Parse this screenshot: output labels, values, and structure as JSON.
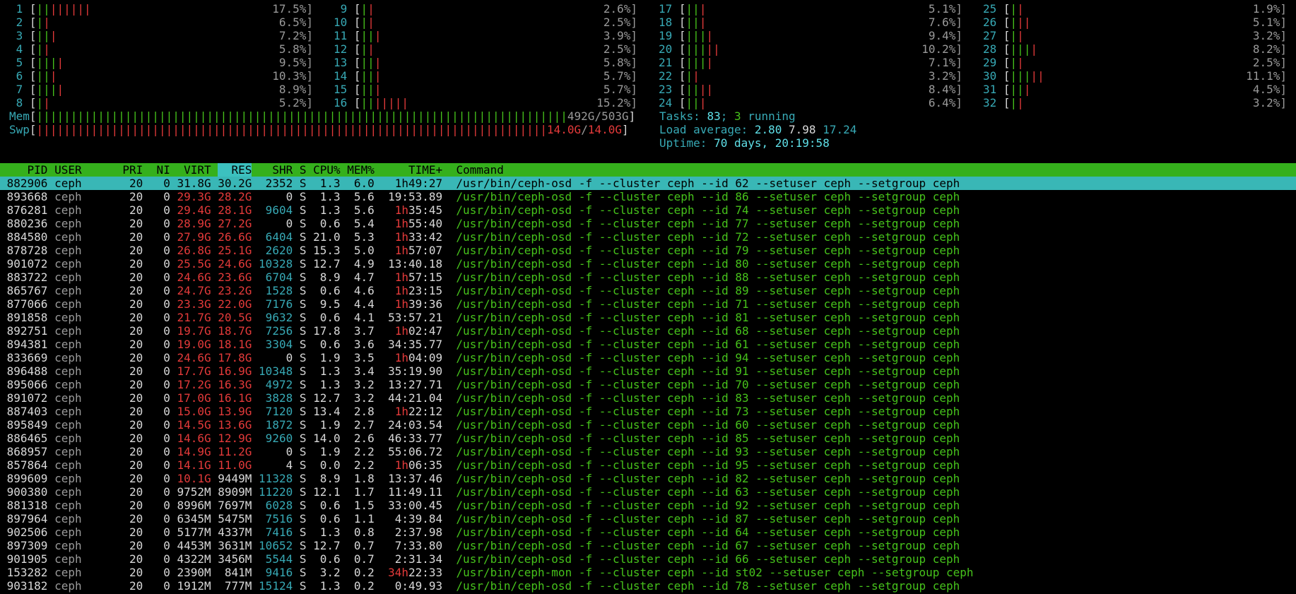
{
  "cpus": [
    {
      "id": "1",
      "pct": "17.5%",
      "bars": [
        [
          "||",
          "green"
        ],
        [
          "||||||",
          "red"
        ]
      ]
    },
    {
      "id": "2",
      "pct": "6.5%",
      "bars": [
        [
          "|",
          "green"
        ],
        [
          "|",
          "red"
        ]
      ]
    },
    {
      "id": "3",
      "pct": "7.2%",
      "bars": [
        [
          "||",
          "green"
        ],
        [
          "|",
          "red"
        ]
      ]
    },
    {
      "id": "4",
      "pct": "5.8%",
      "bars": [
        [
          "|",
          "green"
        ],
        [
          "|",
          "red"
        ]
      ]
    },
    {
      "id": "5",
      "pct": "9.5%",
      "bars": [
        [
          "|||",
          "green"
        ],
        [
          "|",
          "red"
        ]
      ]
    },
    {
      "id": "6",
      "pct": "10.3%",
      "bars": [
        [
          "||",
          "green"
        ],
        [
          "|",
          "red"
        ]
      ]
    },
    {
      "id": "7",
      "pct": "8.9%",
      "bars": [
        [
          "|||",
          "green"
        ],
        [
          "|",
          "red"
        ]
      ]
    },
    {
      "id": "8",
      "pct": "5.2%",
      "bars": [
        [
          "|",
          "green"
        ],
        [
          "|",
          "red"
        ]
      ]
    },
    {
      "id": "9",
      "pct": "2.6%",
      "bars": [
        [
          "|",
          "green"
        ],
        [
          "|",
          "red"
        ]
      ]
    },
    {
      "id": "10",
      "pct": "2.5%",
      "bars": [
        [
          "|",
          "green"
        ],
        [
          "|",
          "red"
        ]
      ]
    },
    {
      "id": "11",
      "pct": "3.9%",
      "bars": [
        [
          "||",
          "green"
        ],
        [
          "|",
          "red"
        ]
      ]
    },
    {
      "id": "12",
      "pct": "2.5%",
      "bars": [
        [
          "|",
          "green"
        ],
        [
          "|",
          "red"
        ]
      ]
    },
    {
      "id": "13",
      "pct": "5.8%",
      "bars": [
        [
          "||",
          "green"
        ],
        [
          "|",
          "red"
        ]
      ]
    },
    {
      "id": "14",
      "pct": "5.7%",
      "bars": [
        [
          "||",
          "green"
        ],
        [
          "|",
          "red"
        ]
      ]
    },
    {
      "id": "15",
      "pct": "5.7%",
      "bars": [
        [
          "||",
          "green"
        ],
        [
          "|",
          "red"
        ]
      ]
    },
    {
      "id": "16",
      "pct": "15.2%",
      "bars": [
        [
          "||",
          "green"
        ],
        [
          "|||||",
          "red"
        ]
      ]
    },
    {
      "id": "17",
      "pct": "5.1%",
      "bars": [
        [
          "||",
          "green"
        ],
        [
          "|",
          "red"
        ]
      ]
    },
    {
      "id": "18",
      "pct": "7.6%",
      "bars": [
        [
          "||",
          "green"
        ],
        [
          "|",
          "red"
        ]
      ]
    },
    {
      "id": "19",
      "pct": "9.4%",
      "bars": [
        [
          "|||",
          "green"
        ],
        [
          "|",
          "red"
        ]
      ]
    },
    {
      "id": "20",
      "pct": "10.2%",
      "bars": [
        [
          "|||",
          "green"
        ],
        [
          "||",
          "red"
        ]
      ]
    },
    {
      "id": "21",
      "pct": "7.1%",
      "bars": [
        [
          "|||",
          "green"
        ],
        [
          "|",
          "red"
        ]
      ]
    },
    {
      "id": "22",
      "pct": "3.2%",
      "bars": [
        [
          "|",
          "green"
        ],
        [
          "|",
          "red"
        ]
      ]
    },
    {
      "id": "23",
      "pct": "8.4%",
      "bars": [
        [
          "||",
          "green"
        ],
        [
          "||",
          "red"
        ]
      ]
    },
    {
      "id": "24",
      "pct": "6.4%",
      "bars": [
        [
          "||",
          "green"
        ],
        [
          "|",
          "red"
        ]
      ]
    },
    {
      "id": "25",
      "pct": "1.9%",
      "bars": [
        [
          "|",
          "green"
        ],
        [
          "|",
          "red"
        ]
      ]
    },
    {
      "id": "26",
      "pct": "5.1%",
      "bars": [
        [
          "|",
          "green"
        ],
        [
          "||",
          "red"
        ]
      ]
    },
    {
      "id": "27",
      "pct": "3.2%",
      "bars": [
        [
          "|",
          "green"
        ],
        [
          "|",
          "red"
        ]
      ]
    },
    {
      "id": "28",
      "pct": "8.2%",
      "bars": [
        [
          "|||",
          "green"
        ],
        [
          "|",
          "red"
        ]
      ]
    },
    {
      "id": "29",
      "pct": "2.5%",
      "bars": [
        [
          "|",
          "green"
        ],
        [
          "|",
          "red"
        ]
      ]
    },
    {
      "id": "30",
      "pct": "11.1%",
      "bars": [
        [
          "|||",
          "green"
        ],
        [
          "||",
          "red"
        ]
      ]
    },
    {
      "id": "31",
      "pct": "4.5%",
      "bars": [
        [
          "||",
          "green"
        ],
        [
          "|",
          "red"
        ]
      ]
    },
    {
      "id": "32",
      "pct": "3.2%",
      "bars": [
        [
          "|",
          "green"
        ],
        [
          "|",
          "red"
        ]
      ]
    }
  ],
  "mem": {
    "label": "Mem",
    "bars": "||||||||||||||||||||||||||||||||||||||||||||||||||||||||||||||||||||||||||||||",
    "used": "492G",
    "total": "503G"
  },
  "swp": {
    "label": "Swp",
    "bars": "|||||||||||||||||||||||||||||||||||||||||||||||||||||||||||||||||||||||||||",
    "used": "14.0G",
    "total": "14.0G"
  },
  "tasks": {
    "label": "Tasks: ",
    "count": "83",
    "sep": "; ",
    "running": "3",
    "running_label": " running"
  },
  "load": {
    "label": "Load average: ",
    "l1": "2.80",
    "l5": "7.98",
    "l15": "17.24"
  },
  "uptime": {
    "label": "Uptime: ",
    "value": "70 days, 20:19:58"
  },
  "header": {
    "pid": "PID",
    "user": "USER",
    "pri": "PRI",
    "ni": "NI",
    "virt": "VIRT",
    "res": "RES",
    "shr": "SHR",
    "s": "S",
    "cpu": "CPU%",
    "mem": "MEM%",
    "time": "TIME+",
    "cmd": "Command"
  },
  "processes": [
    {
      "pid": "882906",
      "user": "ceph",
      "pri": "20",
      "ni": "0",
      "virt": "31.8G",
      "res": "30.2G",
      "shr": "2352",
      "s": "S",
      "cpu": "1.3",
      "mem": "6.0",
      "time_h": "1h",
      "time_r": "49:27",
      "cmd": "/usr/bin/ceph-osd -f --cluster ceph --id 62 --setuser ceph --setgroup ceph"
    },
    {
      "pid": "893668",
      "user": "ceph",
      "pri": "20",
      "ni": "0",
      "virt": "29.3G",
      "res": "28.2G",
      "shr": "0",
      "s": "S",
      "cpu": "1.3",
      "mem": "5.6",
      "time_h": "",
      "time_r": "19:53.89",
      "cmd": "/usr/bin/ceph-osd -f --cluster ceph --id 86 --setuser ceph --setgroup ceph"
    },
    {
      "pid": "876281",
      "user": "ceph",
      "pri": "20",
      "ni": "0",
      "virt": "29.4G",
      "res": "28.1G",
      "shr": "9604",
      "s": "S",
      "cpu": "1.3",
      "mem": "5.6",
      "time_h": "1h",
      "time_r": "35:45",
      "cmd": "/usr/bin/ceph-osd -f --cluster ceph --id 74 --setuser ceph --setgroup ceph"
    },
    {
      "pid": "880236",
      "user": "ceph",
      "pri": "20",
      "ni": "0",
      "virt": "28.9G",
      "res": "27.2G",
      "shr": "0",
      "s": "S",
      "cpu": "0.6",
      "mem": "5.4",
      "time_h": "1h",
      "time_r": "55:40",
      "cmd": "/usr/bin/ceph-osd -f --cluster ceph --id 77 --setuser ceph --setgroup ceph"
    },
    {
      "pid": "884580",
      "user": "ceph",
      "pri": "20",
      "ni": "0",
      "virt": "27.9G",
      "res": "26.6G",
      "shr": "6404",
      "s": "S",
      "cpu": "21.0",
      "mem": "5.3",
      "time_h": "1h",
      "time_r": "33:42",
      "cmd": "/usr/bin/ceph-osd -f --cluster ceph --id 72 --setuser ceph --setgroup ceph"
    },
    {
      "pid": "878728",
      "user": "ceph",
      "pri": "20",
      "ni": "0",
      "virt": "26.8G",
      "res": "25.1G",
      "shr": "2620",
      "s": "S",
      "cpu": "15.3",
      "mem": "5.0",
      "time_h": "1h",
      "time_r": "57:07",
      "cmd": "/usr/bin/ceph-osd -f --cluster ceph --id 79 --setuser ceph --setgroup ceph"
    },
    {
      "pid": "901072",
      "user": "ceph",
      "pri": "20",
      "ni": "0",
      "virt": "25.5G",
      "res": "24.6G",
      "shr": "10328",
      "s": "S",
      "cpu": "12.7",
      "mem": "4.9",
      "time_h": "",
      "time_r": "13:40.18",
      "cmd": "/usr/bin/ceph-osd -f --cluster ceph --id 80 --setuser ceph --setgroup ceph"
    },
    {
      "pid": "883722",
      "user": "ceph",
      "pri": "20",
      "ni": "0",
      "virt": "24.6G",
      "res": "23.6G",
      "shr": "6704",
      "s": "S",
      "cpu": "8.9",
      "mem": "4.7",
      "time_h": "1h",
      "time_r": "57:15",
      "cmd": "/usr/bin/ceph-osd -f --cluster ceph --id 88 --setuser ceph --setgroup ceph"
    },
    {
      "pid": "865767",
      "user": "ceph",
      "pri": "20",
      "ni": "0",
      "virt": "24.7G",
      "res": "23.2G",
      "shr": "1528",
      "s": "S",
      "cpu": "0.6",
      "mem": "4.6",
      "time_h": "1h",
      "time_r": "23:15",
      "cmd": "/usr/bin/ceph-osd -f --cluster ceph --id 89 --setuser ceph --setgroup ceph"
    },
    {
      "pid": "877066",
      "user": "ceph",
      "pri": "20",
      "ni": "0",
      "virt": "23.3G",
      "res": "22.0G",
      "shr": "7176",
      "s": "S",
      "cpu": "9.5",
      "mem": "4.4",
      "time_h": "1h",
      "time_r": "39:36",
      "cmd": "/usr/bin/ceph-osd -f --cluster ceph --id 71 --setuser ceph --setgroup ceph"
    },
    {
      "pid": "891858",
      "user": "ceph",
      "pri": "20",
      "ni": "0",
      "virt": "21.7G",
      "res": "20.5G",
      "shr": "9632",
      "s": "S",
      "cpu": "0.6",
      "mem": "4.1",
      "time_h": "",
      "time_r": "53:57.21",
      "cmd": "/usr/bin/ceph-osd -f --cluster ceph --id 81 --setuser ceph --setgroup ceph"
    },
    {
      "pid": "892751",
      "user": "ceph",
      "pri": "20",
      "ni": "0",
      "virt": "19.7G",
      "res": "18.7G",
      "shr": "7256",
      "s": "S",
      "cpu": "17.8",
      "mem": "3.7",
      "time_h": "1h",
      "time_r": "02:47",
      "cmd": "/usr/bin/ceph-osd -f --cluster ceph --id 68 --setuser ceph --setgroup ceph"
    },
    {
      "pid": "894381",
      "user": "ceph",
      "pri": "20",
      "ni": "0",
      "virt": "19.0G",
      "res": "18.1G",
      "shr": "3304",
      "s": "S",
      "cpu": "0.6",
      "mem": "3.6",
      "time_h": "",
      "time_r": "34:35.77",
      "cmd": "/usr/bin/ceph-osd -f --cluster ceph --id 61 --setuser ceph --setgroup ceph"
    },
    {
      "pid": "833669",
      "user": "ceph",
      "pri": "20",
      "ni": "0",
      "virt": "24.6G",
      "res": "17.8G",
      "shr": "0",
      "s": "S",
      "cpu": "1.9",
      "mem": "3.5",
      "time_h": "1h",
      "time_r": "04:09",
      "cmd": "/usr/bin/ceph-osd -f --cluster ceph --id 94 --setuser ceph --setgroup ceph"
    },
    {
      "pid": "896488",
      "user": "ceph",
      "pri": "20",
      "ni": "0",
      "virt": "17.7G",
      "res": "16.9G",
      "shr": "10348",
      "s": "S",
      "cpu": "1.3",
      "mem": "3.4",
      "time_h": "",
      "time_r": "35:19.90",
      "cmd": "/usr/bin/ceph-osd -f --cluster ceph --id 91 --setuser ceph --setgroup ceph"
    },
    {
      "pid": "895066",
      "user": "ceph",
      "pri": "20",
      "ni": "0",
      "virt": "17.2G",
      "res": "16.3G",
      "shr": "4972",
      "s": "S",
      "cpu": "1.3",
      "mem": "3.2",
      "time_h": "",
      "time_r": "13:27.71",
      "cmd": "/usr/bin/ceph-osd -f --cluster ceph --id 70 --setuser ceph --setgroup ceph"
    },
    {
      "pid": "891072",
      "user": "ceph",
      "pri": "20",
      "ni": "0",
      "virt": "17.0G",
      "res": "16.1G",
      "shr": "3828",
      "s": "S",
      "cpu": "12.7",
      "mem": "3.2",
      "time_h": "",
      "time_r": "44:21.04",
      "cmd": "/usr/bin/ceph-osd -f --cluster ceph --id 83 --setuser ceph --setgroup ceph"
    },
    {
      "pid": "887403",
      "user": "ceph",
      "pri": "20",
      "ni": "0",
      "virt": "15.0G",
      "res": "13.9G",
      "shr": "7120",
      "s": "S",
      "cpu": "13.4",
      "mem": "2.8",
      "time_h": "1h",
      "time_r": "22:12",
      "cmd": "/usr/bin/ceph-osd -f --cluster ceph --id 73 --setuser ceph --setgroup ceph"
    },
    {
      "pid": "895849",
      "user": "ceph",
      "pri": "20",
      "ni": "0",
      "virt": "14.5G",
      "res": "13.6G",
      "shr": "1872",
      "s": "S",
      "cpu": "1.9",
      "mem": "2.7",
      "time_h": "",
      "time_r": "24:03.54",
      "cmd": "/usr/bin/ceph-osd -f --cluster ceph --id 60 --setuser ceph --setgroup ceph"
    },
    {
      "pid": "886465",
      "user": "ceph",
      "pri": "20",
      "ni": "0",
      "virt": "14.6G",
      "res": "12.9G",
      "shr": "9260",
      "s": "S",
      "cpu": "14.0",
      "mem": "2.6",
      "time_h": "",
      "time_r": "46:33.77",
      "cmd": "/usr/bin/ceph-osd -f --cluster ceph --id 85 --setuser ceph --setgroup ceph"
    },
    {
      "pid": "868957",
      "user": "ceph",
      "pri": "20",
      "ni": "0",
      "virt": "14.9G",
      "res": "11.2G",
      "shr": "0",
      "s": "S",
      "cpu": "1.9",
      "mem": "2.2",
      "time_h": "",
      "time_r": "55:06.72",
      "cmd": "/usr/bin/ceph-osd -f --cluster ceph --id 93 --setuser ceph --setgroup ceph"
    },
    {
      "pid": "857864",
      "user": "ceph",
      "pri": "20",
      "ni": "0",
      "virt": "14.1G",
      "res": "11.0G",
      "shr": "4",
      "s": "S",
      "cpu": "0.0",
      "mem": "2.2",
      "time_h": "1h",
      "time_r": "06:35",
      "cmd": "/usr/bin/ceph-osd -f --cluster ceph --id 95 --setuser ceph --setgroup ceph"
    },
    {
      "pid": "899609",
      "user": "ceph",
      "pri": "20",
      "ni": "0",
      "virt": "10.1G",
      "res": "9449M",
      "shr": "11328",
      "s": "S",
      "cpu": "8.9",
      "mem": "1.8",
      "time_h": "",
      "time_r": "13:37.46",
      "cmd": "/usr/bin/ceph-osd -f --cluster ceph --id 82 --setuser ceph --setgroup ceph"
    },
    {
      "pid": "900380",
      "user": "ceph",
      "pri": "20",
      "ni": "0",
      "virt": "9752M",
      "res": "8909M",
      "shr": "11220",
      "s": "S",
      "cpu": "12.1",
      "mem": "1.7",
      "time_h": "",
      "time_r": "11:49.11",
      "cmd": "/usr/bin/ceph-osd -f --cluster ceph --id 63 --setuser ceph --setgroup ceph"
    },
    {
      "pid": "881318",
      "user": "ceph",
      "pri": "20",
      "ni": "0",
      "virt": "8996M",
      "res": "7697M",
      "shr": "6028",
      "s": "S",
      "cpu": "0.6",
      "mem": "1.5",
      "time_h": "",
      "time_r": "33:00.45",
      "cmd": "/usr/bin/ceph-osd -f --cluster ceph --id 92 --setuser ceph --setgroup ceph"
    },
    {
      "pid": "897964",
      "user": "ceph",
      "pri": "20",
      "ni": "0",
      "virt": "6345M",
      "res": "5475M",
      "shr": "7516",
      "s": "S",
      "cpu": "0.6",
      "mem": "1.1",
      "time_h": "",
      "time_r": "4:39.84",
      "cmd": "/usr/bin/ceph-osd -f --cluster ceph --id 87 --setuser ceph --setgroup ceph"
    },
    {
      "pid": "902506",
      "user": "ceph",
      "pri": "20",
      "ni": "0",
      "virt": "5177M",
      "res": "4337M",
      "shr": "7416",
      "s": "S",
      "cpu": "1.3",
      "mem": "0.8",
      "time_h": "",
      "time_r": "2:37.98",
      "cmd": "/usr/bin/ceph-osd -f --cluster ceph --id 64 --setuser ceph --setgroup ceph"
    },
    {
      "pid": "897309",
      "user": "ceph",
      "pri": "20",
      "ni": "0",
      "virt": "4453M",
      "res": "3631M",
      "shr": "10652",
      "s": "S",
      "cpu": "12.7",
      "mem": "0.7",
      "time_h": "",
      "time_r": "7:33.80",
      "cmd": "/usr/bin/ceph-osd -f --cluster ceph --id 67 --setuser ceph --setgroup ceph"
    },
    {
      "pid": "901905",
      "user": "ceph",
      "pri": "20",
      "ni": "0",
      "virt": "4322M",
      "res": "3456M",
      "shr": "5544",
      "s": "S",
      "cpu": "0.6",
      "mem": "0.7",
      "time_h": "",
      "time_r": "2:31.34",
      "cmd": "/usr/bin/ceph-osd -f --cluster ceph --id 66 --setuser ceph --setgroup ceph"
    },
    {
      "pid": "153282",
      "user": "ceph",
      "pri": "20",
      "ni": "0",
      "virt": "2390M",
      "res": "841M",
      "shr": "9416",
      "s": "S",
      "cpu": "3.2",
      "mem": "0.2",
      "time_h": "34h",
      "time_r": "22:33",
      "cmd": "/usr/bin/ceph-mon -f --cluster ceph --id st02 --setuser ceph --setgroup ceph"
    },
    {
      "pid": "903182",
      "user": "ceph",
      "pri": "20",
      "ni": "0",
      "virt": "1912M",
      "res": "777M",
      "shr": "15124",
      "s": "S",
      "cpu": "1.3",
      "mem": "0.2",
      "time_h": "",
      "time_r": "0:49.93",
      "cmd": "/usr/bin/ceph-osd -f --cluster ceph --id 78 --setuser ceph --setgroup ceph"
    }
  ]
}
